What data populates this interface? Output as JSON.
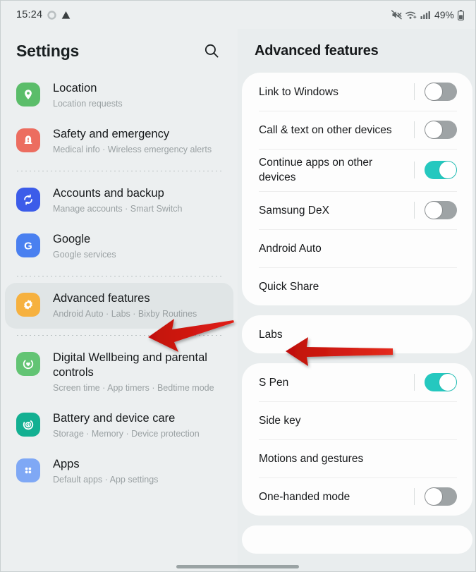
{
  "status_bar": {
    "time": "15:24",
    "left_icons": [
      "loading-spinner-icon",
      "warning-triangle-icon"
    ],
    "right_icons": [
      "mute-icon",
      "wifi-icon",
      "cellular-signal-icon"
    ],
    "battery_percent": "49%"
  },
  "sidebar": {
    "title": "Settings",
    "search_icon": "search-icon",
    "items": [
      {
        "label": "Location",
        "sub": "Location requests",
        "icon": "location-pin-icon",
        "color": "#5bbd6a",
        "selected": false
      },
      {
        "label": "Safety and emergency",
        "sub": "Medical info  ·  Wireless emergency alerts",
        "icon": "safety-emergency-icon",
        "color": "#ec6d60",
        "selected": false
      },
      {
        "label": "Accounts and backup",
        "sub": "Manage accounts  ·  Smart Switch",
        "icon": "sync-accounts-icon",
        "color": "#3c5ce9",
        "selected": false
      },
      {
        "label": "Google",
        "sub": "Google services",
        "icon": "google-g-icon",
        "color": "#4a80f0",
        "selected": false
      },
      {
        "label": "Advanced features",
        "sub": "Android Auto  ·  Labs  ·  Bixby Routines",
        "icon": "gear-advanced-icon",
        "color": "#f6b13f",
        "selected": true
      },
      {
        "label": "Digital Wellbeing and parental controls",
        "sub": "Screen time  ·  App timers  ·  Bedtime mode",
        "icon": "wellbeing-heart-icon",
        "color": "#63c474",
        "selected": false
      },
      {
        "label": "Battery and device care",
        "sub": "Storage  ·  Memory  ·  Device protection",
        "icon": "battery-care-icon",
        "color": "#13b092",
        "selected": false
      },
      {
        "label": "Apps",
        "sub": "Default apps  ·  App settings",
        "icon": "apps-grid-icon",
        "color": "#7fa8f5",
        "selected": false
      }
    ]
  },
  "detail": {
    "title": "Advanced features",
    "cards": [
      {
        "rows": [
          {
            "label": "Link to Windows",
            "toggle": "off"
          },
          {
            "label": "Call & text on other devices",
            "toggle": "off"
          },
          {
            "label": "Continue apps on other devices",
            "toggle": "on"
          },
          {
            "label": "Samsung DeX",
            "toggle": "off"
          },
          {
            "label": "Android Auto",
            "toggle": "none"
          },
          {
            "label": "Quick Share",
            "toggle": "none"
          }
        ]
      },
      {
        "rows": [
          {
            "label": "Labs",
            "toggle": "none"
          }
        ]
      },
      {
        "rows": [
          {
            "label": "S Pen",
            "toggle": "on"
          },
          {
            "label": "Side key",
            "toggle": "none"
          },
          {
            "label": "Motions and gestures",
            "toggle": "none"
          },
          {
            "label": "One-handed mode",
            "toggle": "off"
          }
        ]
      }
    ]
  },
  "annotations": {
    "arrow_color": "#d31911",
    "arrows": [
      {
        "name": "arrow-to-advanced-features",
        "points_to": "Advanced features"
      },
      {
        "name": "arrow-to-labs",
        "points_to": "Labs"
      }
    ]
  },
  "colors": {
    "accent_toggle_on": "#25c8bf",
    "toggle_off": "#9ea3a5",
    "background": "#eceff0",
    "card": "#fdfdfd",
    "selected_row": "#e0e5e6"
  }
}
